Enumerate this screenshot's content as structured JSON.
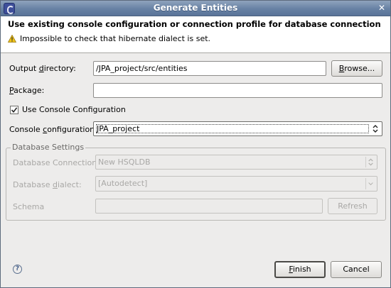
{
  "window": {
    "title": "Generate Entities",
    "close_glyph": "✕"
  },
  "header": {
    "title": "Use existing console configuration or connection profile for database connection",
    "message": "Impossible to check that hibernate dialect is set."
  },
  "form": {
    "output_directory": {
      "label_pre": "Output ",
      "label_mnemonic": "d",
      "label_post": "irectory:",
      "value": "/JPA_project/src/entities",
      "browse_mnemonic": "B",
      "browse_rest": "rowse..."
    },
    "package": {
      "label_mnemonic": "P",
      "label_post": "ackage:",
      "value": ""
    },
    "use_console_configuration": {
      "label": "Use Console Configuration",
      "checked": true
    },
    "console_configuration": {
      "label_pre": "Console ",
      "label_mnemonic": "c",
      "label_post": "onfiguration:",
      "value": "JPA_project"
    }
  },
  "database_settings": {
    "group_label": "Database Settings",
    "connection_label": "Database Connection",
    "connection_value": "New HSQLDB",
    "dialect_label_pre": "Database ",
    "dialect_mnemonic": "d",
    "dialect_label_post": "ialect:",
    "dialect_value": "[Autodetect]",
    "schema_label": "Schema",
    "schema_value": "",
    "refresh_label": "Refresh"
  },
  "footer": {
    "help_glyph": "?",
    "finish_mnemonic": "F",
    "finish_rest": "inish",
    "cancel_label": "Cancel"
  },
  "colors": {
    "titlebar": "#6781a4",
    "dialog_bg": "#edeceb",
    "warning": "#f0c419"
  }
}
